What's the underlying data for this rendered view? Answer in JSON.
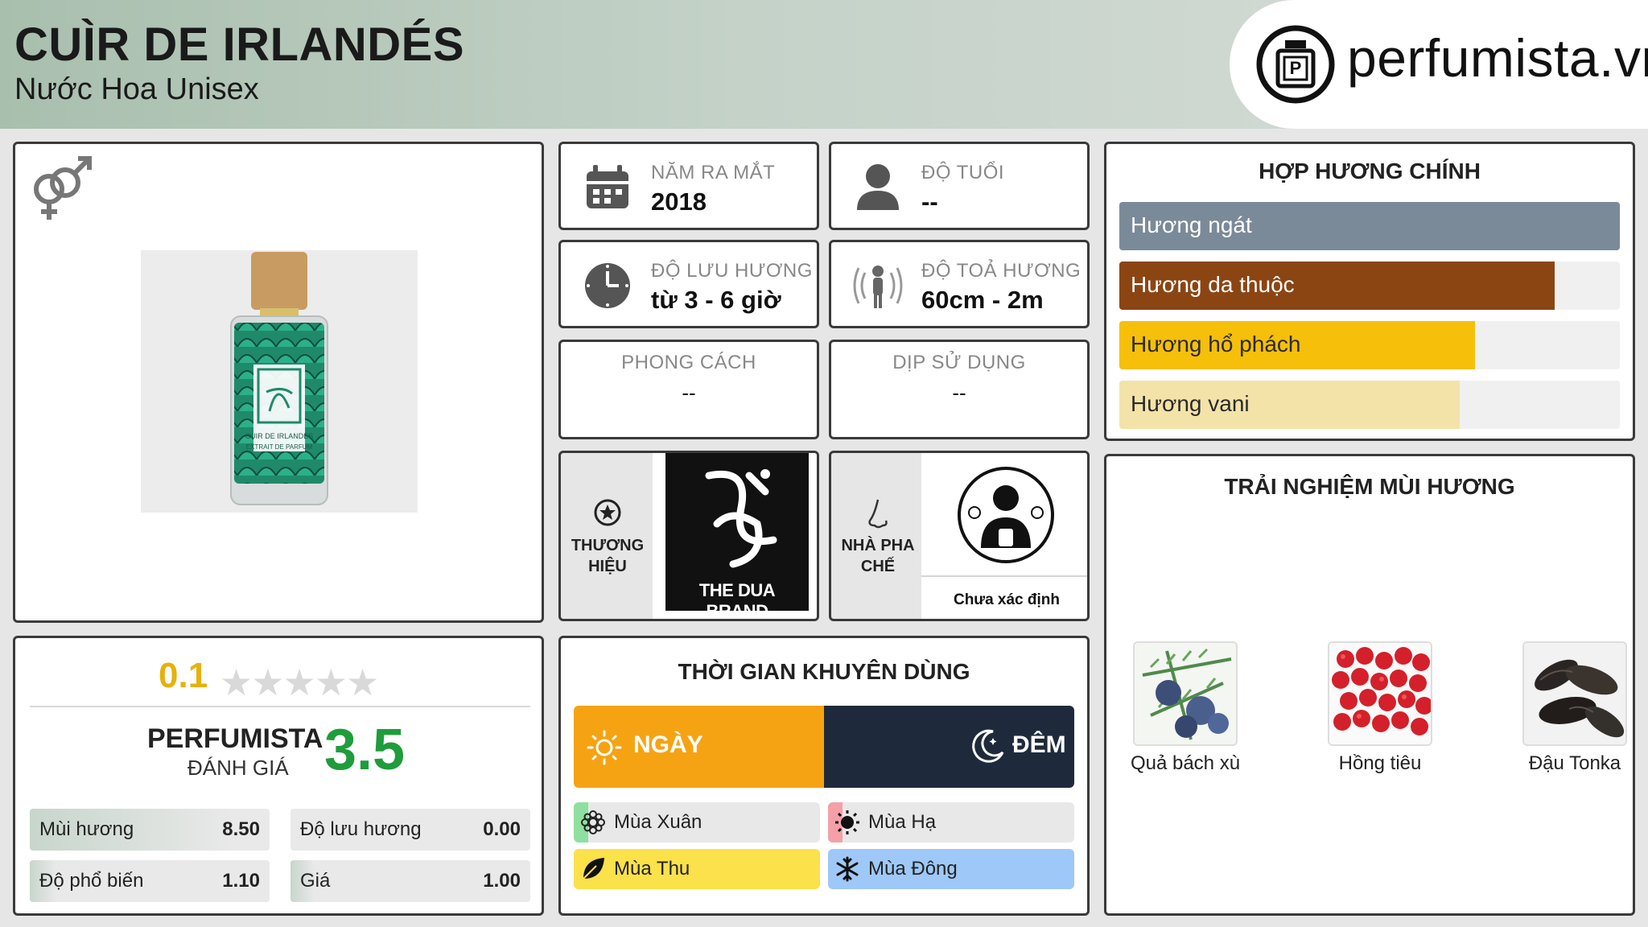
{
  "header": {
    "title": "CUÌR DE IRLANDÉS",
    "subtitle": "Nước Hoa Unisex",
    "logo_text": "perfumista.vn"
  },
  "info": {
    "year_label": "NĂM RA MẮT",
    "year_value": "2018",
    "age_label": "ĐỘ TUỔI",
    "age_value": "--",
    "longevity_label": "ĐỘ LƯU HƯƠNG",
    "longevity_value": "từ 3 - 6 giờ",
    "sillage_label": "ĐỘ TOẢ HƯƠNG",
    "sillage_value": "60cm - 2m",
    "style_label": "PHONG CÁCH",
    "style_value": "--",
    "occasion_label": "DỊP SỬ DỤNG",
    "occasion_value": "--",
    "brand_label_1": "THƯƠNG",
    "brand_label_2": "HIỆU",
    "brand_name": "THE DUA BRAND",
    "perfumer_label_1": "NHÀ PHA",
    "perfumer_label_2": "CHẾ",
    "perfumer_name": "Chưa xác định"
  },
  "bottle_label": "CUIR DE IRLANDES",
  "bottle_sub": "EXTRAIT DE PARFUM",
  "accords": {
    "title": "HỢP HƯƠNG CHÍNH",
    "items": [
      {
        "label": "Hương ngát",
        "percent": 100,
        "color": "#7a8a99"
      },
      {
        "label": "Hương da thuộc",
        "percent": 87,
        "color": "#8b4513"
      },
      {
        "label": "Hương hổ phách",
        "percent": 71,
        "color": "#f5bf0a"
      },
      {
        "label": "Hương vani",
        "percent": 68,
        "color": "#f3e3a8"
      }
    ]
  },
  "notes": {
    "title": "TRẢI NGHIỆM MÙI HƯƠNG",
    "items": [
      {
        "label": "Quả bách xù",
        "icon": "juniper-icon"
      },
      {
        "label": "Hồng tiêu",
        "icon": "pink-pepper-icon"
      },
      {
        "label": "Đậu Tonka",
        "icon": "tonka-bean-icon"
      }
    ]
  },
  "rating": {
    "user_score": "0.1",
    "stars_filled": 0.1,
    "stars_total": 5,
    "pf_title": "PERFUMISTA",
    "pf_sub": "ĐÁNH GIÁ",
    "pf_score": "3.5",
    "metrics": [
      {
        "name": "Mùi hương",
        "value": "8.50",
        "fraction": 0.85
      },
      {
        "name": "Độ lưu hương",
        "value": "0.00",
        "fraction": 0.0
      },
      {
        "name": "Độ phổ biến",
        "value": "1.10",
        "fraction": 0.11
      },
      {
        "name": "Giá",
        "value": "1.00",
        "fraction": 0.1
      }
    ]
  },
  "time": {
    "title": "THỜI GIAN KHUYÊN DÙNG",
    "day_label": "NGÀY",
    "night_label": "ĐÊM",
    "seasons": [
      {
        "label": "Mùa Xuân",
        "fraction": 0.06,
        "color": "#8fe0a0",
        "icon": "flower-icon"
      },
      {
        "label": "Mùa Hạ",
        "fraction": 0.06,
        "color": "#f4a0a8",
        "icon": "sun-icon"
      },
      {
        "label": "Mùa Thu",
        "fraction": 1.0,
        "color": "#fbe14a",
        "icon": "leaf-icon"
      },
      {
        "label": "Mùa Đông",
        "fraction": 1.0,
        "color": "#9ec8f7",
        "icon": "snowflake-icon"
      }
    ]
  }
}
